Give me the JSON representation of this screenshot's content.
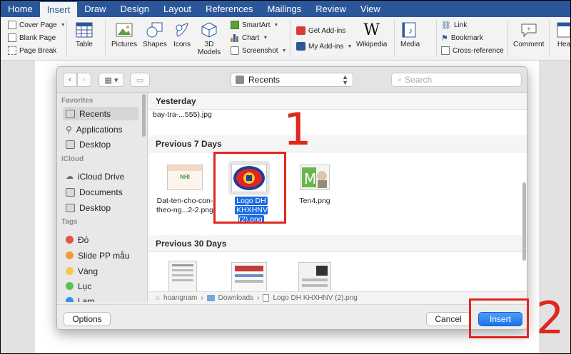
{
  "ribbon": {
    "tabs": [
      "Home",
      "Insert",
      "Draw",
      "Design",
      "Layout",
      "References",
      "Mailings",
      "Review",
      "View"
    ],
    "active_tab": "Insert",
    "pages_group": [
      "Cover Page",
      "Blank Page",
      "Page Break"
    ],
    "table": "Table",
    "pictures": "Pictures",
    "shapes": "Shapes",
    "icons": "Icons",
    "models_3d": "3D\nModels",
    "smartart": "SmartArt",
    "chart": "Chart",
    "screenshot": "Screenshot",
    "get_addins": "Get Add-ins",
    "my_addins": "My Add-ins",
    "wikipedia": "Wikipedia",
    "media": "Media",
    "link": "Link",
    "bookmark": "Bookmark",
    "cross_reference": "Cross-reference",
    "comment": "Comment",
    "header_partial": "Hea"
  },
  "dialog": {
    "location": "Recents",
    "search_placeholder": "Search",
    "sidebar": {
      "favorites_header": "Favorites",
      "favorites": [
        "Recents",
        "Applications",
        "Desktop"
      ],
      "icloud_header": "iCloud",
      "icloud": [
        "iCloud Drive",
        "Documents",
        "Desktop"
      ],
      "tags_header": "Tags",
      "tags": [
        {
          "label": "Đỏ",
          "color": "#e5534b"
        },
        {
          "label": "Slide PP mẫu",
          "color": "#f29b38"
        },
        {
          "label": "Vàng",
          "color": "#f2c94c"
        },
        {
          "label": "Lục",
          "color": "#5ac05a"
        },
        {
          "label": "Lam",
          "color": "#3b8ef0"
        }
      ]
    },
    "sections": {
      "yesterday": "Yesterday",
      "yesterday_file": "bay-tra-...555).jpg",
      "previous_7": "Previous 7 Days",
      "previous_30": "Previous 30 Days"
    },
    "files_7": [
      {
        "name_line1": "Dat-ten-cho-con-",
        "name_line2": "theo-ng...2-2.png",
        "thumb_text": "NHI"
      },
      {
        "name_line1": "Logo DH",
        "name_line2": "KHXHNV (2).png"
      },
      {
        "name_line1": "Ten4.png",
        "name_line2": ""
      }
    ],
    "path": [
      "hoangnam",
      "Downloads",
      "Logo DH KHXHNV (2).png"
    ],
    "buttons": {
      "options": "Options",
      "cancel": "Cancel",
      "insert": "Insert"
    }
  },
  "annotations": {
    "step1": "1",
    "step2": "2",
    "color": "#e0271f"
  }
}
